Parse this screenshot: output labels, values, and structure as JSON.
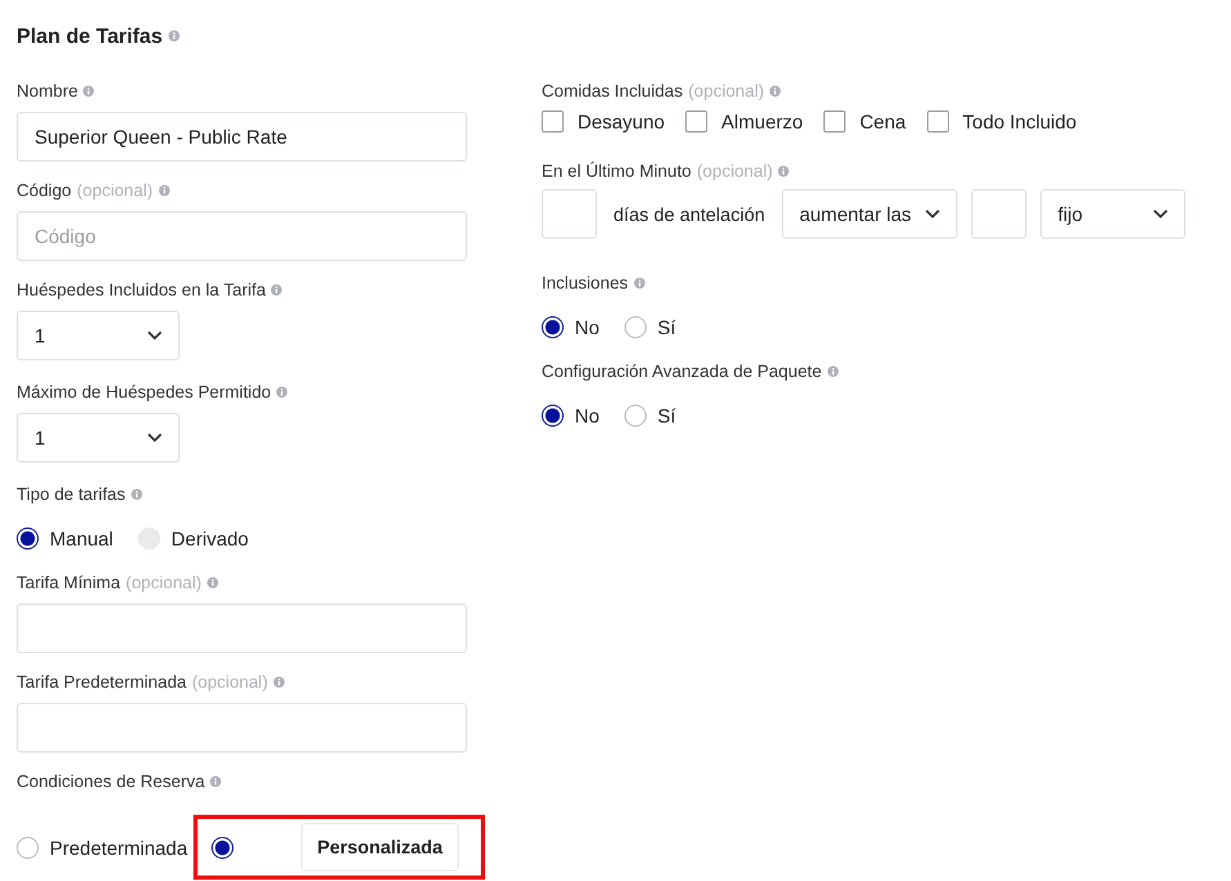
{
  "title": "Plan de Tarifas",
  "left": [
    {
      "kind": "text",
      "label": "Nombre",
      "value": "Superior Queen - Public Rate"
    },
    {
      "kind": "text",
      "label": "Código",
      "optional": "(opcional)",
      "placeholder": "Código"
    },
    {
      "kind": "select",
      "label": "Huéspedes Incluidos en la Tarifa",
      "value": "1"
    },
    {
      "kind": "select",
      "label": "Máximo de Huéspedes Permitido",
      "value": "1"
    },
    {
      "kind": "radio",
      "label": "Tipo de tarifas",
      "options": [
        {
          "label": "Manual",
          "selected": true
        },
        {
          "label": "Derivado",
          "selected": false,
          "disabled": true
        }
      ]
    },
    {
      "kind": "text",
      "label": "Tarifa Mínima",
      "optional": "(opcional)"
    },
    {
      "kind": "text",
      "label": "Tarifa Predeterminada",
      "optional": "(opcional)"
    },
    {
      "kind": "radio",
      "label": "Condiciones de Reserva",
      "options": [
        {
          "label": "Predeterminada",
          "selected": false
        },
        {
          "label": "Personalizada",
          "selected": true,
          "highlighted": true
        }
      ]
    }
  ],
  "right": [
    {
      "kind": "checks",
      "label": "Comidas Incluidas",
      "optional": "(opcional)",
      "options": [
        {
          "label": "Desayuno",
          "checked": false
        },
        {
          "label": "Almuerzo",
          "checked": false
        },
        {
          "label": "Cena",
          "checked": false
        },
        {
          "label": "Todo Incluido",
          "checked": false
        }
      ]
    },
    {
      "kind": "row",
      "label": "En el Último Minuto",
      "optional": "(opcional)",
      "items": [
        {
          "kind": "input"
        },
        {
          "kind": "text",
          "text": "días de antelación"
        },
        {
          "kind": "select",
          "value": "aumentar las"
        },
        {
          "kind": "input"
        },
        {
          "kind": "select",
          "value": "fijo"
        }
      ]
    },
    {
      "kind": "radio",
      "label": "Inclusiones",
      "options": [
        {
          "label": "No",
          "selected": true
        },
        {
          "label": "Sí",
          "selected": false
        }
      ]
    },
    {
      "kind": "radio",
      "label": "Configuración Avanzada de Paquete",
      "options": [
        {
          "label": "No",
          "selected": true
        },
        {
          "label": "Sí",
          "selected": false
        }
      ]
    }
  ]
}
